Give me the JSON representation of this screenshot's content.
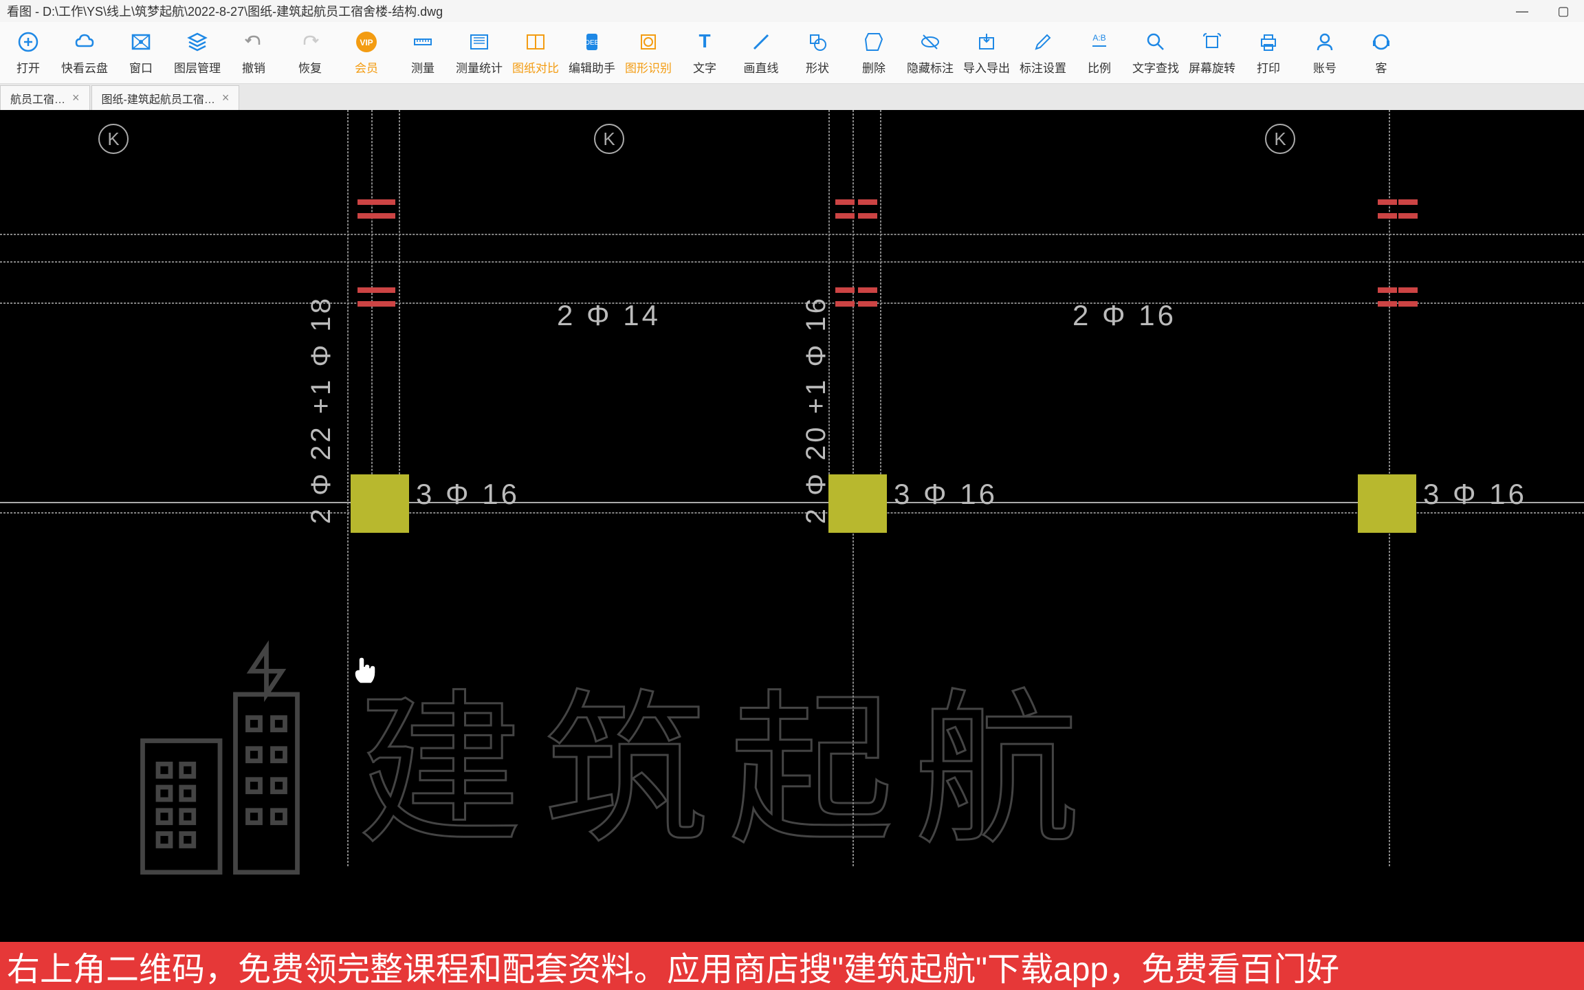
{
  "title": "看图 - D:\\工作\\YS\\线上\\筑梦起航\\2022-8-27\\图纸-建筑起航员工宿舍楼-结构.dwg",
  "window": {
    "min": "—",
    "max": "▢",
    "close": "✕"
  },
  "toolbar": [
    {
      "id": "open",
      "label": "打开",
      "icon": "file-icon",
      "color": "#1e88e5"
    },
    {
      "id": "cloud",
      "label": "快看云盘",
      "icon": "cloud-icon",
      "color": "#1e88e5"
    },
    {
      "id": "window",
      "label": "窗口",
      "icon": "window-icon",
      "color": "#1e88e5"
    },
    {
      "id": "layers",
      "label": "图层管理",
      "icon": "layers-icon",
      "color": "#1e88e5"
    },
    {
      "id": "undo",
      "label": "撤销",
      "icon": "undo-icon",
      "color": "#999"
    },
    {
      "id": "redo",
      "label": "恢复",
      "icon": "redo-icon",
      "color": "#ccc"
    },
    {
      "id": "vip",
      "label": "会员",
      "icon": "vip-icon",
      "color": "#f39c12",
      "orange": true
    },
    {
      "id": "measure",
      "label": "测量",
      "icon": "ruler-icon",
      "color": "#1e88e5"
    },
    {
      "id": "stats",
      "label": "测量统计",
      "icon": "stats-icon",
      "color": "#1e88e5"
    },
    {
      "id": "compare",
      "label": "图纸对比",
      "icon": "compare-icon",
      "color": "#f39c12",
      "orange": true
    },
    {
      "id": "edit",
      "label": "编辑助手",
      "icon": "edit-icon",
      "color": "#1e88e5"
    },
    {
      "id": "recognize",
      "label": "图形识别",
      "icon": "recognize-icon",
      "color": "#f39c12",
      "orange": true
    },
    {
      "id": "text",
      "label": "文字",
      "icon": "text-icon",
      "color": "#1e88e5"
    },
    {
      "id": "line",
      "label": "画直线",
      "icon": "line-icon",
      "color": "#1e88e5"
    },
    {
      "id": "shape",
      "label": "形状",
      "icon": "shape-icon",
      "color": "#1e88e5"
    },
    {
      "id": "delete",
      "label": "删除",
      "icon": "delete-icon",
      "color": "#1e88e5"
    },
    {
      "id": "hide",
      "label": "隐藏标注",
      "icon": "hide-icon",
      "color": "#1e88e5"
    },
    {
      "id": "export",
      "label": "导入导出",
      "icon": "export-icon",
      "color": "#1e88e5"
    },
    {
      "id": "marksettings",
      "label": "标注设置",
      "icon": "mark-settings-icon",
      "color": "#1e88e5"
    },
    {
      "id": "scale",
      "label": "比例",
      "icon": "scale-icon",
      "color": "#1e88e5"
    },
    {
      "id": "find",
      "label": "文字查找",
      "icon": "find-icon",
      "color": "#1e88e5"
    },
    {
      "id": "rotate",
      "label": "屏幕旋转",
      "icon": "rotate-icon",
      "color": "#1e88e5"
    },
    {
      "id": "print",
      "label": "打印",
      "icon": "print-icon",
      "color": "#1e88e5"
    },
    {
      "id": "account",
      "label": "账号",
      "icon": "account-icon",
      "color": "#1e88e5"
    },
    {
      "id": "service",
      "label": "客",
      "icon": "service-icon",
      "color": "#1e88e5"
    }
  ],
  "tabs": [
    {
      "label": "航员工宿…"
    },
    {
      "label": "图纸-建筑起航员工宿…"
    }
  ],
  "cad": {
    "k_label": "K",
    "dim_top": "2",
    "rebar_214": "2 Φ 14",
    "rebar_216": "2 Φ 16",
    "rebar_316_a": "3 Φ 16",
    "rebar_316_b": "3 Φ 16",
    "rebar_316_c": "3 Φ 16",
    "rebar_v1": "2 Φ 22 +1 Φ 18",
    "rebar_v2": "2 Φ 20 +1 Φ 16"
  },
  "watermark_text": "建筑起航",
  "banner_text": "右上角二维码，免费领完整课程和配套资料。应用商店搜\"建筑起航\"下载app，免费看百门好"
}
